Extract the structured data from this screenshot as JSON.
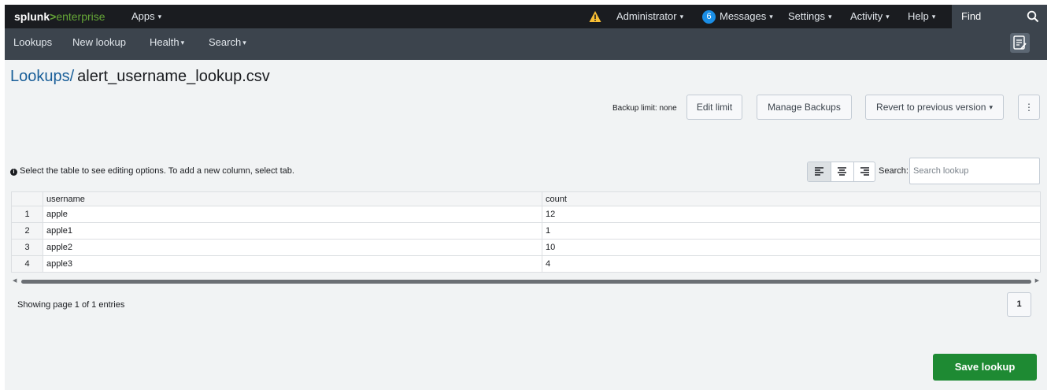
{
  "topbar": {
    "logo_splunk": "splunk",
    "logo_gt": ">",
    "logo_enterprise": "enterprise",
    "apps": "Apps",
    "warning_icon": "warning-triangle-icon",
    "administrator": "Administrator",
    "messages_count": "6",
    "messages": "Messages",
    "settings": "Settings",
    "activity": "Activity",
    "help": "Help",
    "find": "Find",
    "caret": "▾"
  },
  "appbar": {
    "items": [
      "Lookups",
      "New lookup",
      "Health",
      "Search"
    ],
    "notes_icon": "notes-edit-icon"
  },
  "page": {
    "breadcrumb": "Lookups/",
    "filename": "alert_username_lookup.csv"
  },
  "backup": {
    "label": "Backup limit: none",
    "edit_limit": "Edit limit",
    "manage_backups": "Manage Backups",
    "revert": "Revert to previous version",
    "more": "⋮"
  },
  "info": {
    "text": "Select the table to see editing options. To add a new column, select tab.",
    "icon": "info-circle-icon"
  },
  "toolbar": {
    "align_left_icon": "align-left-icon",
    "align_center_icon": "align-center-icon",
    "align_right_icon": "align-right-icon",
    "search_label": "Search:",
    "search_placeholder": "Search lookup"
  },
  "table": {
    "columns": [
      "username",
      "count"
    ],
    "rows": [
      {
        "num": "1",
        "username": "apple",
        "count": "12"
      },
      {
        "num": "2",
        "username": "apple1",
        "count": "1"
      },
      {
        "num": "3",
        "username": "apple2",
        "count": "10"
      },
      {
        "num": "4",
        "username": "apple3",
        "count": "4"
      }
    ]
  },
  "paging": {
    "showing": "Showing page 1 of 1 entries",
    "page": "1"
  },
  "actions": {
    "save": "Save lookup"
  },
  "colors": {
    "topbar_bg": "#1a1c20",
    "appbar_bg": "#3c444d",
    "page_bg": "#f1f3f4",
    "link": "#1a5f99",
    "save_green": "#1e8a33",
    "badge_blue": "#1a8ee6",
    "logo_green": "#65a637"
  }
}
